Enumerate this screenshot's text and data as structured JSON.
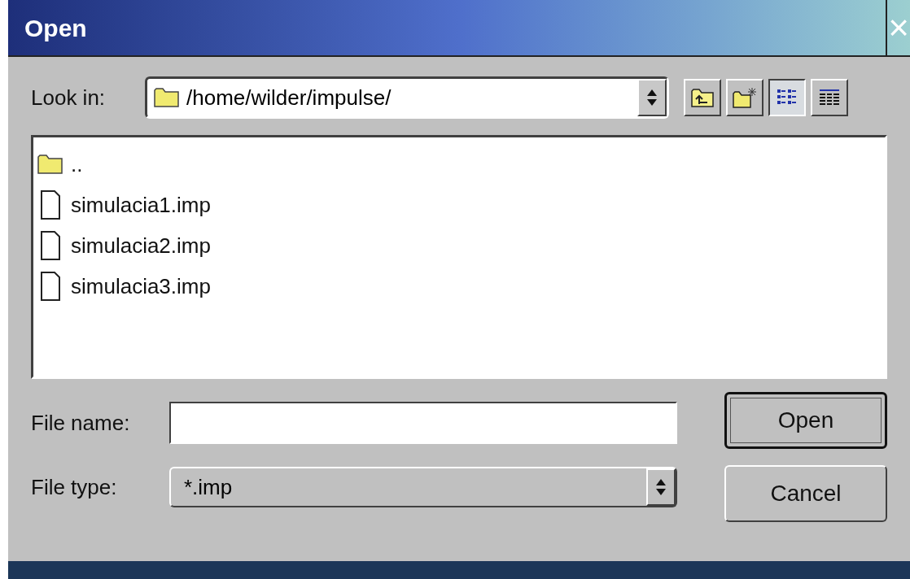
{
  "window": {
    "title": "Open",
    "close": "×"
  },
  "look_in": {
    "label": "Look in:",
    "value": "/home/wilder/impulse/"
  },
  "view_buttons": [
    {
      "kind": "parent",
      "selected": false
    },
    {
      "kind": "newfolder",
      "selected": false
    },
    {
      "kind": "list",
      "selected": true
    },
    {
      "kind": "detail",
      "selected": false
    }
  ],
  "files": [
    {
      "kind": "folder",
      "name": ".."
    },
    {
      "kind": "file",
      "name": "simulacia1.imp"
    },
    {
      "kind": "file",
      "name": "simulacia2.imp"
    },
    {
      "kind": "file",
      "name": "simulacia3.imp"
    }
  ],
  "file_name": {
    "label": "File name:"
  },
  "file_type": {
    "label": "File type:",
    "value": "*.imp"
  },
  "buttons": [
    "Open",
    "Cancel"
  ]
}
